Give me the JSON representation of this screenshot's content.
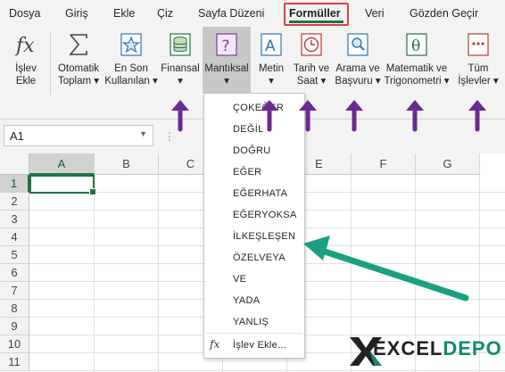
{
  "menu": {
    "tabs": [
      "Dosya",
      "Giriş",
      "Ekle",
      "Çiz",
      "Sayfa Düzeni",
      "Formüller",
      "Veri",
      "Gözden Geçir"
    ],
    "active_tab": "Formüller"
  },
  "ribbon": {
    "insert_function": {
      "line1": "İşlev",
      "line2": "Ekle"
    },
    "autosum": {
      "line1": "Otomatik",
      "line2": "Toplam ▾"
    },
    "recent": {
      "line1": "En Son",
      "line2": "Kullanılan ▾"
    },
    "financial": {
      "line1": "Finansal",
      "line2": "▾"
    },
    "logical": {
      "line1": "Mantıksal",
      "line2": "▾"
    },
    "text": {
      "line1": "Metin",
      "line2": "▾"
    },
    "datetime": {
      "line1": "Tarih ve",
      "line2": "Saat ▾"
    },
    "lookup": {
      "line1": "Arama ve",
      "line2": "Başvuru ▾"
    },
    "math": {
      "line1": "Matematik ve",
      "line2": "Trigonometri ▾"
    },
    "more": {
      "line1": "Tüm",
      "line2": "İşlevler ▾"
    }
  },
  "formula_bar": {
    "name_box": "A1",
    "dots": "⋮"
  },
  "grid": {
    "columns": [
      "A",
      "B",
      "C",
      "D",
      "E",
      "F",
      "G"
    ],
    "rows": [
      "1",
      "2",
      "3",
      "4",
      "5",
      "6",
      "7",
      "8",
      "9",
      "10",
      "11"
    ],
    "selected_column": "A",
    "selected_row": "1"
  },
  "dropdown": {
    "items": [
      "ÇOKEĞER",
      "DEĞİL",
      "DOĞRU",
      "EĞER",
      "EĞERHATA",
      "EĞERYOKSA",
      "İLKEŞLEŞEN",
      "ÖZELVEYA",
      "VE",
      "YADA",
      "YANLIŞ"
    ],
    "insert_function_label": "İşlev Ekle...",
    "fx_symbol": "fx"
  },
  "colors": {
    "accent_green": "#217346",
    "highlight_red": "#e04040",
    "arrow_purple": "#6a2a8f",
    "arrow_teal": "#1aa081",
    "logo_teal": "#138a72"
  },
  "logo": {
    "part1": "EXCEL",
    "part2": "DEPO"
  }
}
